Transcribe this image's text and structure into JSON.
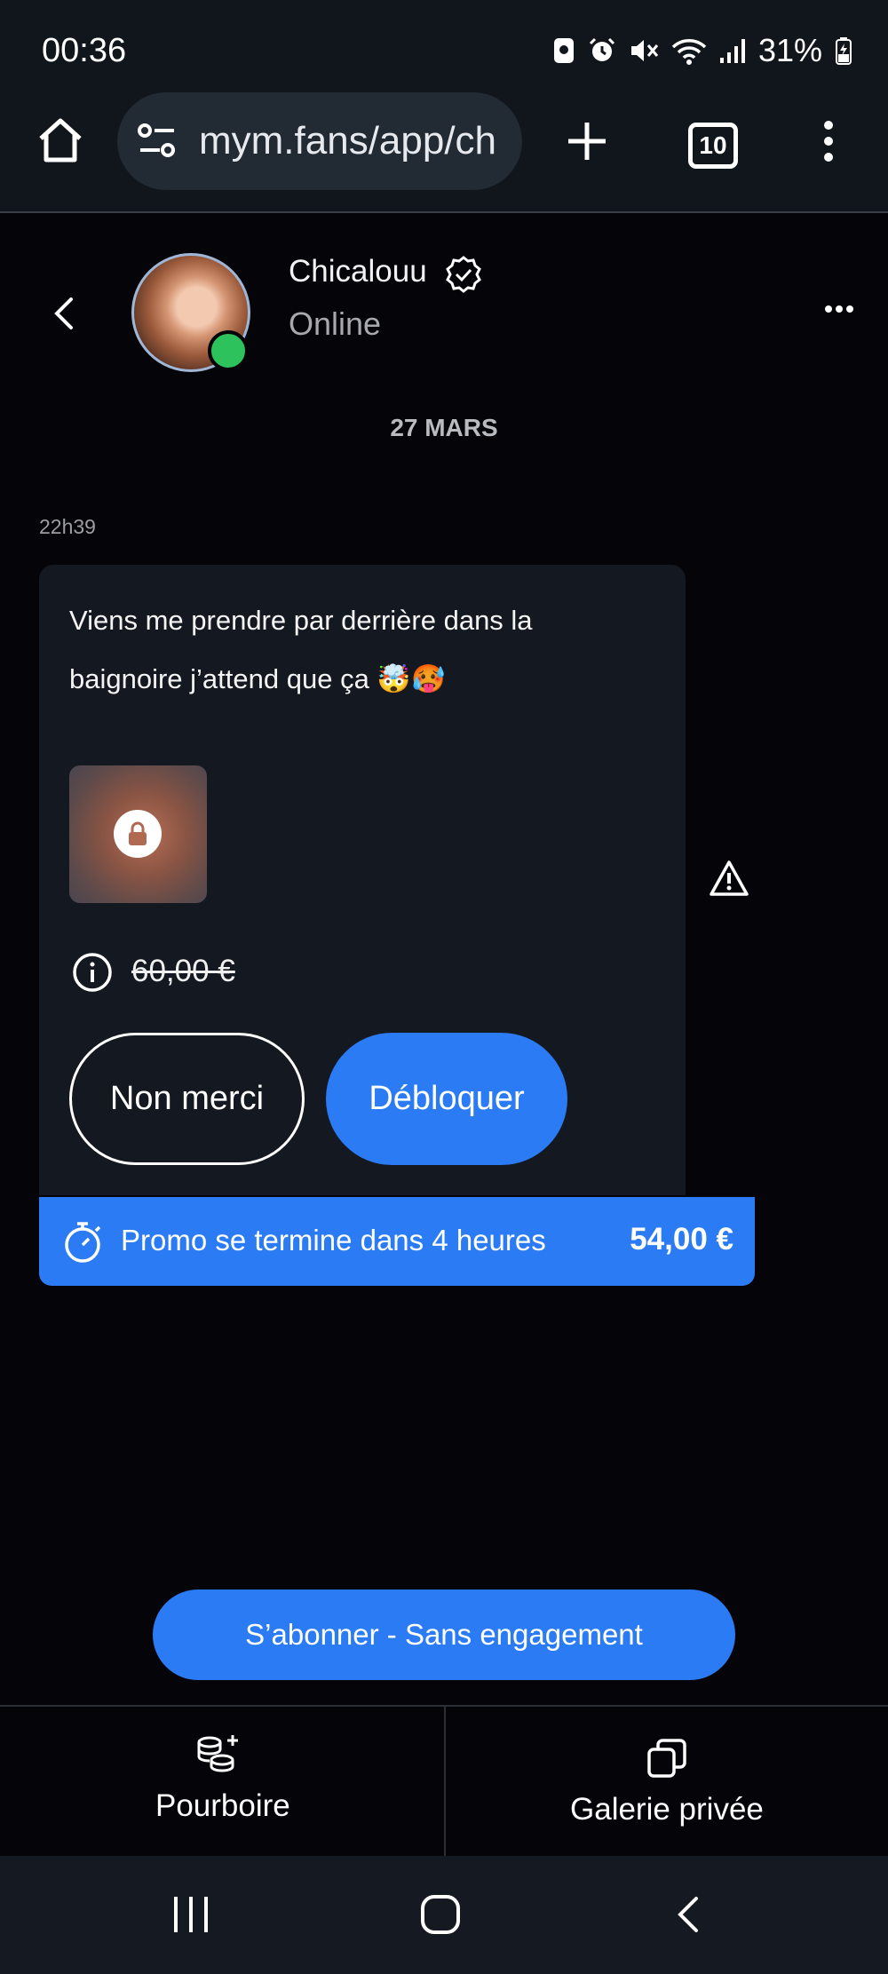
{
  "status_bar": {
    "time": "00:36",
    "battery": "31%"
  },
  "browser": {
    "url": "mym.fans/app/ch",
    "tab_count": "10"
  },
  "chat_header": {
    "name": "Chicalouu",
    "presence": "Online"
  },
  "conversation": {
    "date": "27 MARS",
    "time": "22h39",
    "message": {
      "line1": "Viens me prendre par derrière dans la",
      "line2": "baignoire j’attend que ça 🤯🥵",
      "old_price": "60,00 €",
      "decline_label": "Non merci",
      "unlock_label": "Débloquer"
    },
    "promo": {
      "text": "Promo se termine dans 4 heures",
      "price": "54,00 €"
    }
  },
  "subscribe_label": "S’abonner - Sans engagement",
  "bottom_tabs": [
    {
      "label": "Pourboire",
      "icon": "coins-plus-icon"
    },
    {
      "label": "Galerie privée",
      "icon": "gallery-copy-icon"
    }
  ],
  "colors": {
    "accent": "#2b7bf5",
    "background": "#040409",
    "card": "#141820",
    "online": "#2ec25d"
  }
}
